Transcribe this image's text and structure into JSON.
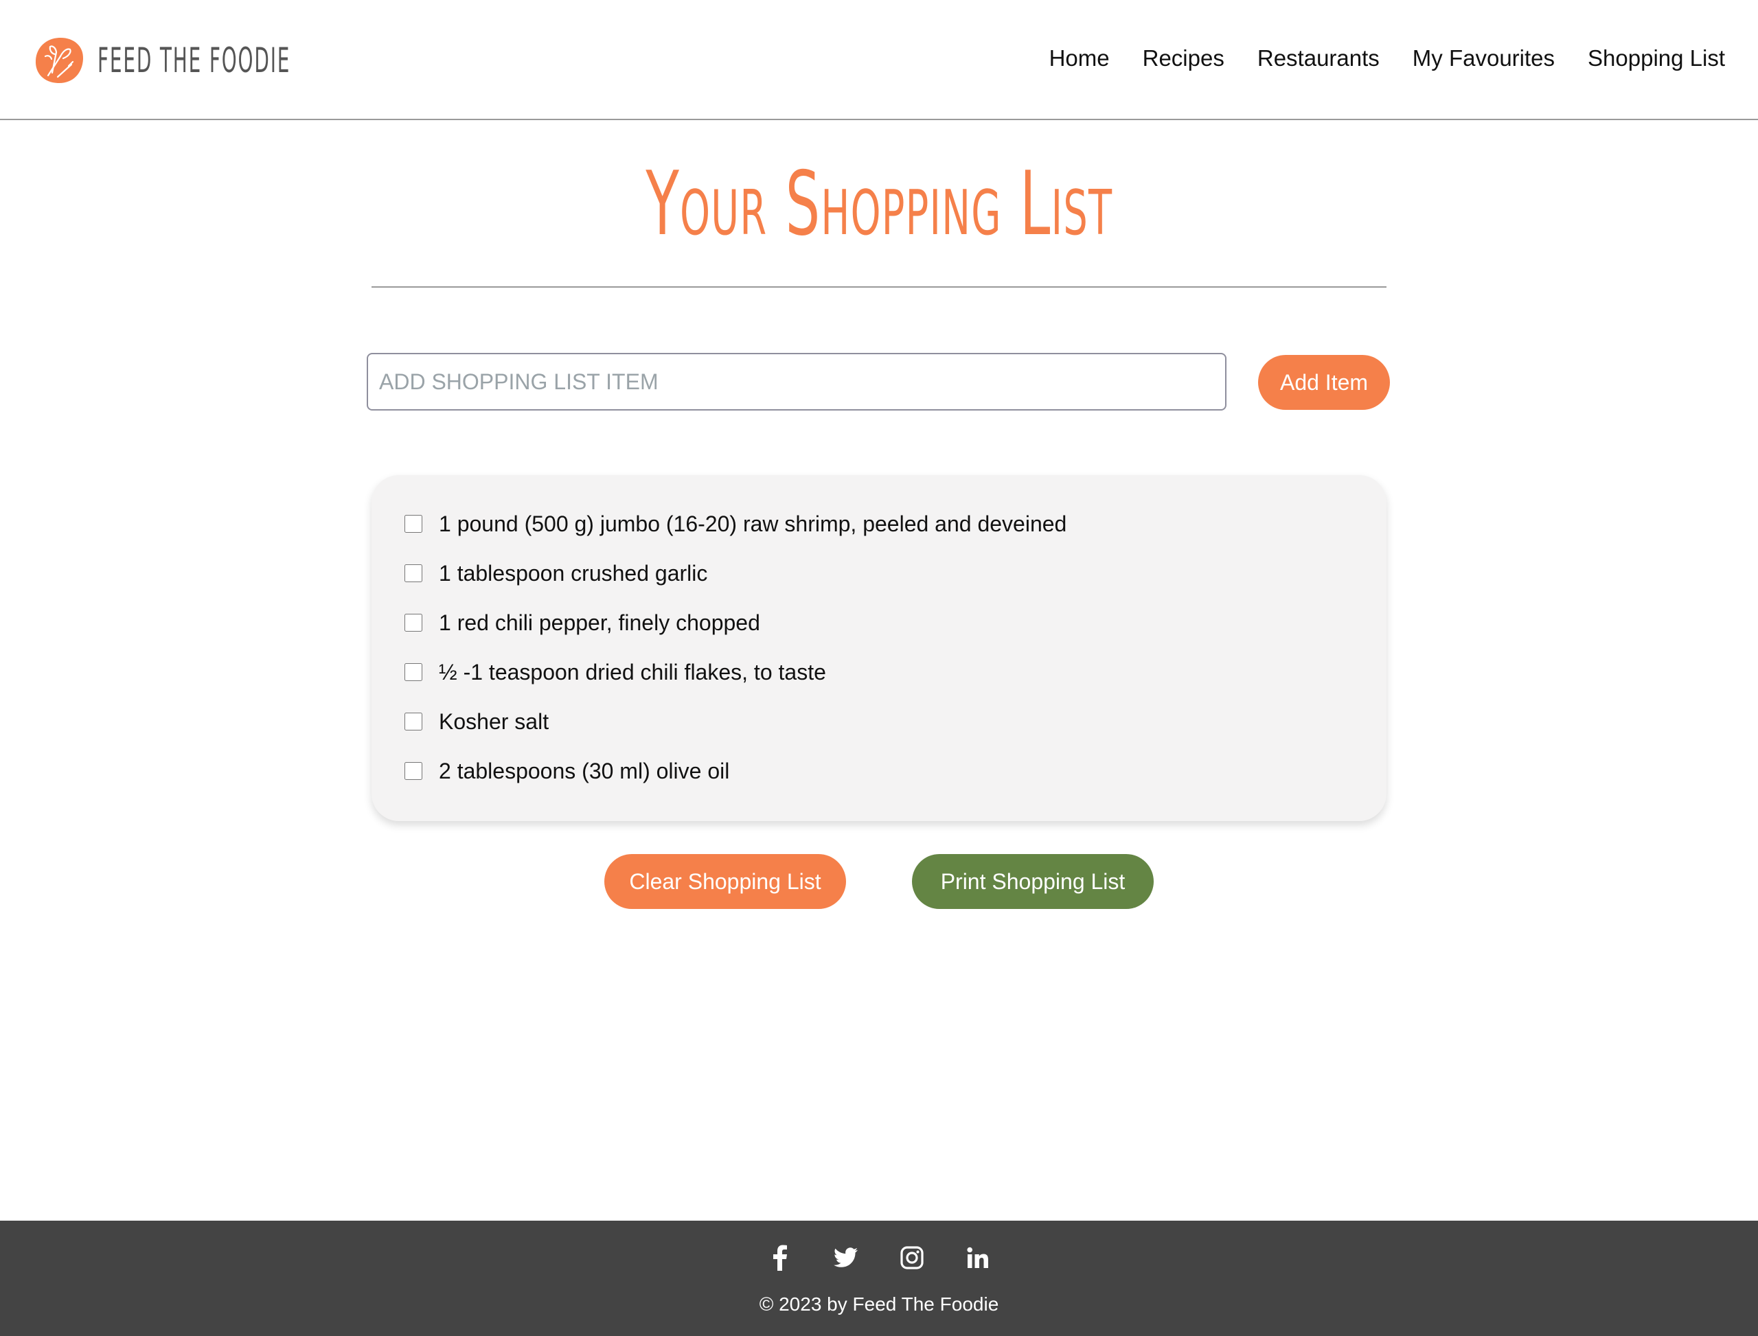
{
  "brand": {
    "name": "Feed The Foodie",
    "accent_color": "#f5804a"
  },
  "nav": {
    "items": [
      {
        "label": "Home"
      },
      {
        "label": "Recipes"
      },
      {
        "label": "Restaurants"
      },
      {
        "label": "My Favourites"
      },
      {
        "label": "Shopping List"
      }
    ]
  },
  "page": {
    "title": "Your Shopping List"
  },
  "add_item": {
    "placeholder": "ADD SHOPPING LIST ITEM",
    "value": "",
    "button_label": "Add Item"
  },
  "shopping_list": {
    "items": [
      {
        "label": "1 pound (500 g) jumbo (16-20) raw shrimp, peeled and deveined",
        "checked": false
      },
      {
        "label": "1 tablespoon crushed garlic",
        "checked": false
      },
      {
        "label": "1 red chili pepper, finely chopped",
        "checked": false
      },
      {
        "label": "½ -1 teaspoon dried chili flakes, to taste",
        "checked": false
      },
      {
        "label": "Kosher salt",
        "checked": false
      },
      {
        "label": "2 tablespoons (30 ml) olive oil",
        "checked": false
      }
    ]
  },
  "actions": {
    "clear_label": "Clear Shopping List",
    "print_label": "Print Shopping List",
    "clear_color": "#f5804a",
    "print_color": "#648544"
  },
  "footer": {
    "socials": [
      {
        "icon": "facebook-icon"
      },
      {
        "icon": "twitter-icon"
      },
      {
        "icon": "instagram-icon"
      },
      {
        "icon": "linkedin-icon"
      }
    ],
    "copyright": "© 2023 by Feed The Foodie",
    "background_color": "#444444"
  }
}
